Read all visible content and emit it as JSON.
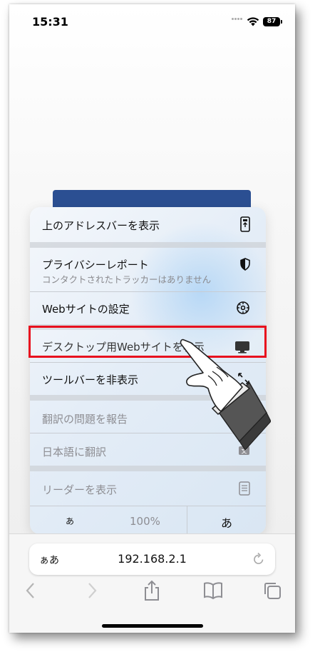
{
  "status_bar": {
    "time": "15:31",
    "battery": "87"
  },
  "menu": {
    "items": [
      {
        "label": "上のアドレスバーを表示",
        "icon": "phone-address-top-icon"
      },
      {
        "label": "プライバシーレポート",
        "sublabel": "コンタクトされたトラッカーはありません",
        "icon": "shield-icon"
      },
      {
        "label": "Webサイトの設定",
        "icon": "gear-icon"
      },
      {
        "label": "デスクトップ用Webサイトを表示",
        "icon": "desktop-icon"
      },
      {
        "label": "ツールバーを非表示",
        "icon": "expand-arrows-icon"
      },
      {
        "label": "翻訳の問題を報告",
        "icon": ""
      },
      {
        "label": "日本語に翻訳",
        "icon": "translate-icon"
      },
      {
        "label": "リーダーを表示",
        "icon": "reader-icon"
      }
    ],
    "text_size": {
      "smaller": "あ",
      "value": "100%",
      "larger": "あ"
    }
  },
  "highlight": {
    "color": "#e8101e"
  },
  "address_bar": {
    "aa": "ぁあ",
    "url": "192.168.2.1"
  },
  "toolbar": {
    "icons": [
      "back-icon",
      "forward-icon",
      "share-icon",
      "bookmarks-icon",
      "tabs-icon"
    ]
  }
}
